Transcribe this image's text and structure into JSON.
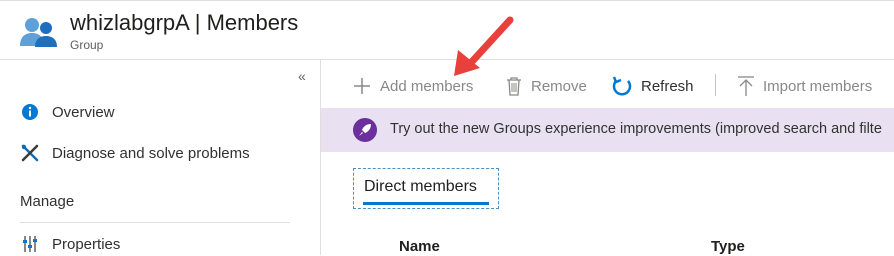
{
  "header": {
    "title": "whizlabgrpA | Members",
    "subtitle": "Group",
    "icon": "users-group-icon"
  },
  "sidebar": {
    "collapse_glyph": "«",
    "items": [
      {
        "label": "Overview",
        "icon": "info-icon"
      },
      {
        "label": "Diagnose and solve problems",
        "icon": "wrench-icon"
      }
    ],
    "section_label": "Manage",
    "manage_items": [
      {
        "label": "Properties",
        "icon": "properties-icon"
      }
    ]
  },
  "toolbar": {
    "add_members": "Add members",
    "remove": "Remove",
    "refresh": "Refresh",
    "import_members": "Import members"
  },
  "banner": {
    "text": "Try out the new Groups experience improvements (improved search and filte",
    "icon": "rocket-icon"
  },
  "tabs": {
    "direct_members": "Direct members"
  },
  "table": {
    "columns": [
      "Name",
      "Type"
    ]
  },
  "colors": {
    "accent": "#0078d4",
    "banner_bg": "#e9e1f2",
    "banner_icon": "#6b2f9e",
    "arrow": "#e8403a"
  }
}
